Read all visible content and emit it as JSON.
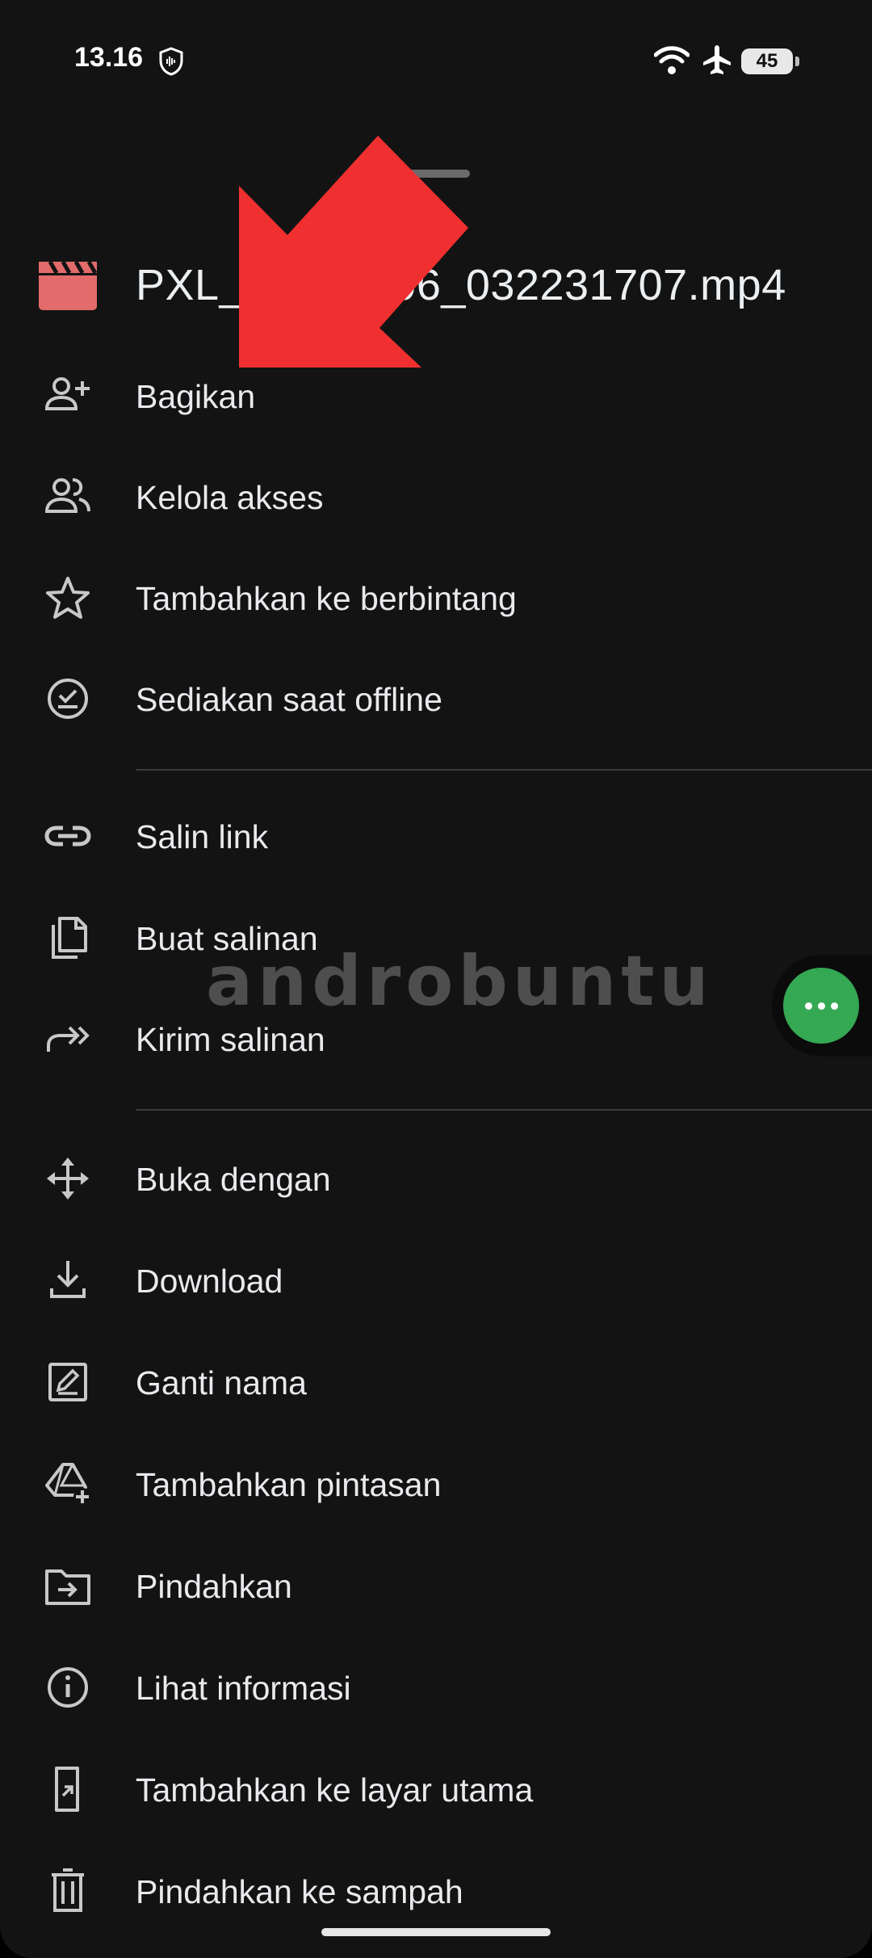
{
  "status_bar": {
    "time": "13.16",
    "battery": "45",
    "icons": [
      "shield-icon",
      "wifi-icon",
      "airplane-icon",
      "battery-icon"
    ]
  },
  "file": {
    "name": "PXL_20230306_032231707.mp4",
    "icon": "video-file-icon",
    "icon_color": "#e36b6b"
  },
  "menu": [
    {
      "label": "Bagikan",
      "icon": "person-add-icon"
    },
    {
      "label": "Kelola akses",
      "icon": "people-icon"
    },
    {
      "label": "Tambahkan ke berbintang",
      "icon": "star-icon"
    },
    {
      "label": "Sediakan saat offline",
      "icon": "offline-check-icon"
    },
    {
      "label": "Salin link",
      "icon": "link-icon"
    },
    {
      "label": "Buat salinan",
      "icon": "copy-icon"
    },
    {
      "label": "Kirim salinan",
      "icon": "forward-icon"
    },
    {
      "label": "Buka dengan",
      "icon": "open-with-icon"
    },
    {
      "label": "Download",
      "icon": "download-icon"
    },
    {
      "label": "Ganti nama",
      "icon": "rename-icon"
    },
    {
      "label": "Tambahkan pintasan",
      "icon": "add-shortcut-icon"
    },
    {
      "label": "Pindahkan",
      "icon": "move-folder-icon"
    },
    {
      "label": "Lihat informasi",
      "icon": "info-icon"
    },
    {
      "label": "Tambahkan ke layar utama",
      "icon": "add-home-screen-icon"
    },
    {
      "label": "Pindahkan ke sampah",
      "icon": "trash-icon"
    }
  ],
  "watermark": "androbuntu",
  "colors": {
    "background": "#131313",
    "annotation_arrow": "#f03030",
    "bubble": "#34a853"
  }
}
